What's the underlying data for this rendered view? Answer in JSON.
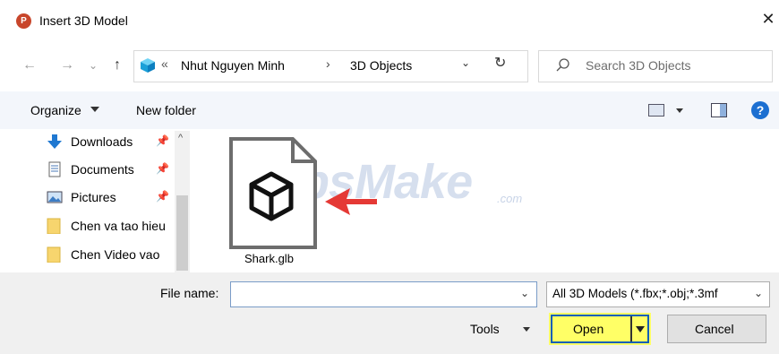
{
  "window": {
    "title": "Insert 3D Model",
    "app_icon_letter": "P",
    "close_glyph": "✕"
  },
  "nav": {
    "back_glyph": "←",
    "forward_glyph": "→",
    "recent_glyph": "⌄",
    "up_glyph": "↑",
    "overflow_glyph": "«",
    "breadcrumb": [
      "Nhut Nguyen Minh",
      "3D Objects"
    ],
    "separator": "›",
    "dropdown_glyph": "⌄",
    "refresh_glyph": "↻",
    "search_placeholder": "Search 3D Objects"
  },
  "toolbar": {
    "organize_label": "Organize",
    "new_folder_label": "New folder",
    "help_glyph": "?"
  },
  "nav_pane": {
    "items": [
      {
        "label": "Downloads",
        "icon": "download-arrow-icon",
        "pinned": true
      },
      {
        "label": "Documents",
        "icon": "documents-icon",
        "pinned": true
      },
      {
        "label": "Pictures",
        "icon": "pictures-icon",
        "pinned": true
      },
      {
        "label": "Chen va tao hieu",
        "icon": "folder-icon",
        "pinned": false
      },
      {
        "label": "Chen Video vao",
        "icon": "folder-icon",
        "pinned": false
      }
    ],
    "pin_glyph": "📌",
    "scroll_up_glyph": "^"
  },
  "files": [
    {
      "name": "Shark.glb",
      "icon": "3d-model-file-icon",
      "selected": false
    }
  ],
  "watermark": {
    "text": "TipsMake",
    "suffix": ".com"
  },
  "bottom": {
    "file_name_label": "File name:",
    "file_name_value": "",
    "file_type_filter": "All 3D Models (*.fbx;*.obj;*.3mf",
    "tools_label": "Tools",
    "open_label": "Open",
    "cancel_label": "Cancel",
    "dropdown_glyph": "⌄"
  },
  "colors": {
    "accent_blue": "#0b5fb7",
    "highlight_yellow": "#ffff66",
    "toolbar_bg": "#f3f6fb",
    "bottom_bg": "#f0f0f0",
    "app_icon": "#c8462b",
    "arrow_red": "#e53935"
  }
}
